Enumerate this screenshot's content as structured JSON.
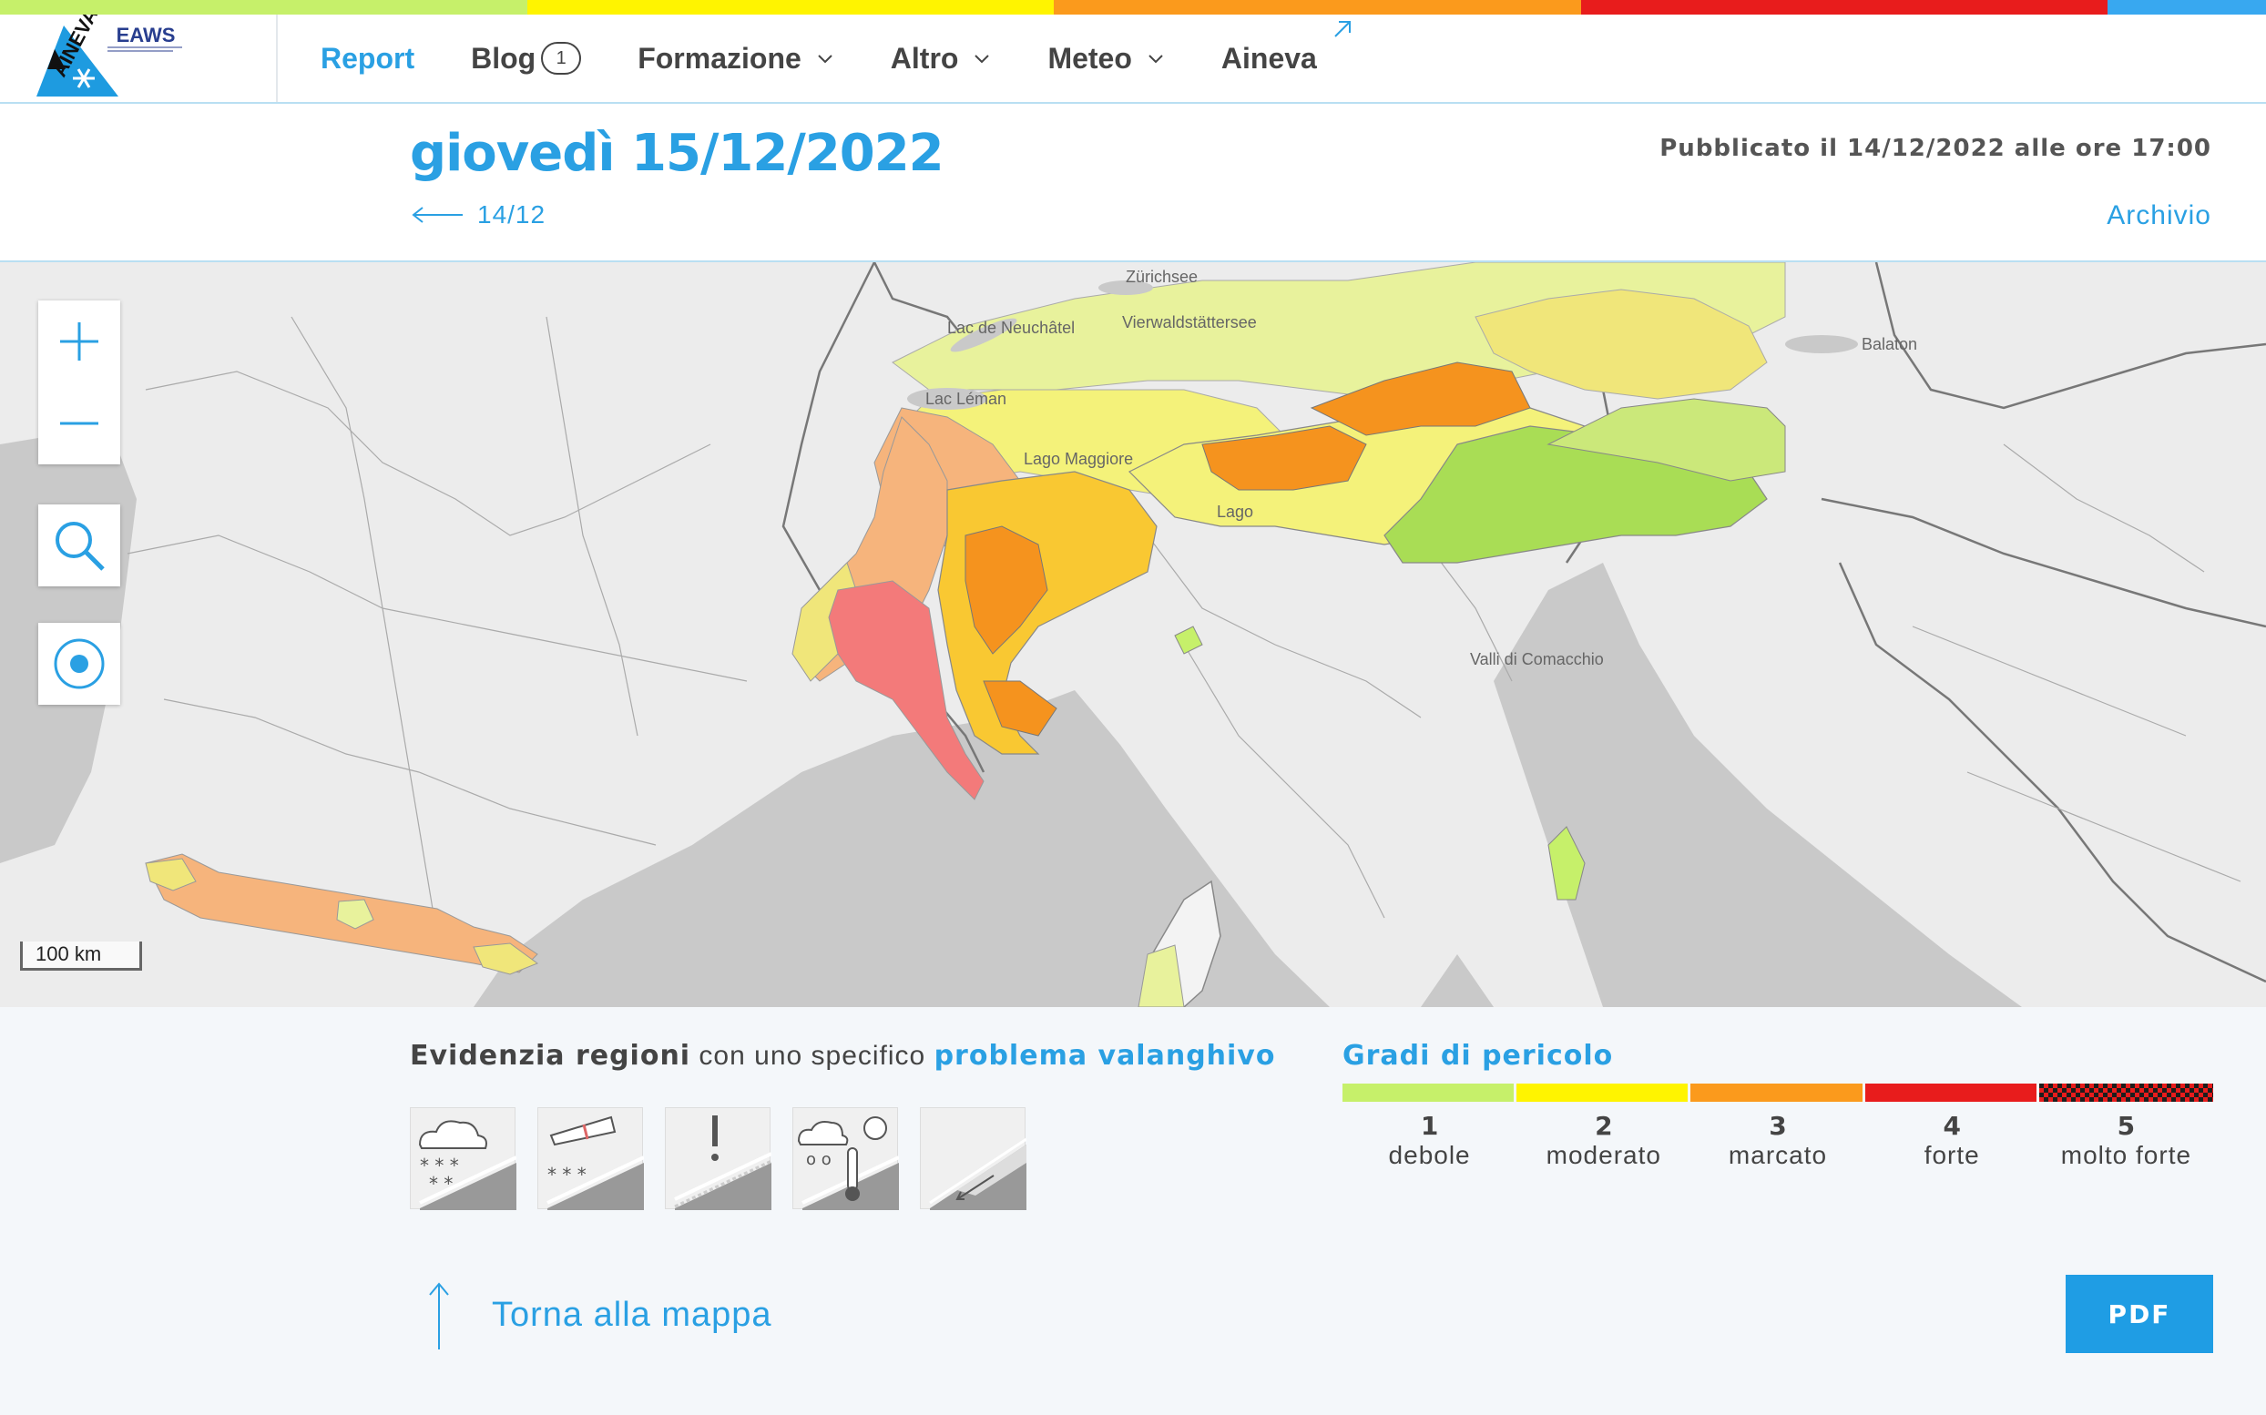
{
  "colors": {
    "accent": "#2aa0e3",
    "danger_1": "#c6f06a",
    "danger_2": "#fff400",
    "danger_3": "#fb9a1c",
    "danger_4": "#e81c1c",
    "danger_5": "#1d1d1d",
    "stripe_blue": "#38a8f0"
  },
  "header": {
    "logo_left": "AINEVA",
    "logo_right": "EAWS",
    "nav": [
      {
        "label": "Report",
        "active": true
      },
      {
        "label": "Blog",
        "badge": "1"
      },
      {
        "label": "Formazione",
        "dropdown": true
      },
      {
        "label": "Altro",
        "dropdown": true
      },
      {
        "label": "Meteo",
        "dropdown": true
      },
      {
        "label": "Aineva",
        "external": true
      }
    ]
  },
  "report": {
    "date_title": "giovedì 15/12/2022",
    "published": "Pubblicato il 14/12/2022 alle ore 17:00",
    "prev_label": "14/12",
    "archive_label": "Archivio"
  },
  "map": {
    "scale_label": "100 km",
    "place_labels": [
      "Zürichsee",
      "Lac de Neuchâtel",
      "Vierwaldstättersee",
      "Lac Léman",
      "Lago Maggiore",
      "Lago",
      "Balaton",
      "Valli di Comacchio"
    ],
    "controls": [
      "zoom-in-icon",
      "zoom-out-icon",
      "search-icon",
      "locate-icon"
    ]
  },
  "legend": {
    "highlight_prefix": "Evidenzia regioni",
    "highlight_middle": " con uno specifico ",
    "highlight_link": "problema valanghivo",
    "problems": [
      "new-snow-icon",
      "wind-slab-icon",
      "persistent-weak-layer-icon",
      "wet-snow-icon",
      "gliding-snow-icon"
    ],
    "gradi_title": "Gradi di pericolo",
    "levels": [
      {
        "num": "1",
        "label": "debole"
      },
      {
        "num": "2",
        "label": "moderato"
      },
      {
        "num": "3",
        "label": "marcato"
      },
      {
        "num": "4",
        "label": "forte"
      },
      {
        "num": "5",
        "label": "molto forte"
      }
    ]
  },
  "footer": {
    "back_label": "Torna alla mappa",
    "pdf_label": "PDF"
  }
}
